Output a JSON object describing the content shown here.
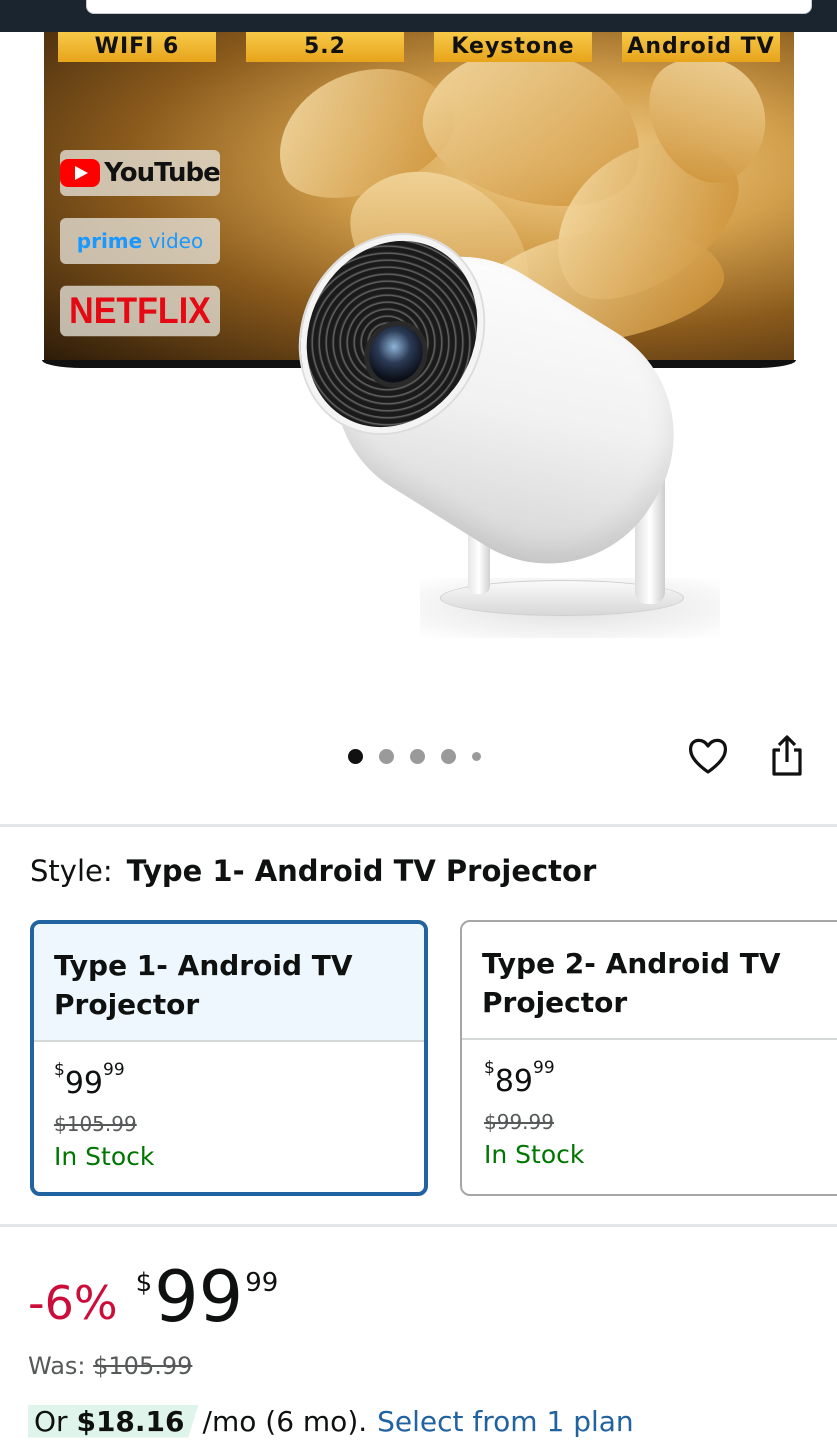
{
  "gallery": {
    "feature_tags": [
      "WIFI 6",
      "5.2",
      "Keystone",
      "Android TV"
    ],
    "app_badges": {
      "youtube": "YouTube",
      "prime_a": "prime",
      "prime_b": "video",
      "netflix": "NETFLIX"
    },
    "page_count": 5,
    "current_index": 0
  },
  "actions": {
    "wishlist_icon": "heart-outline-icon",
    "share_icon": "share-icon"
  },
  "style": {
    "label": "Style:",
    "value": "Type 1- Android TV Projector"
  },
  "options": [
    {
      "title_line1": "Type 1- Android TV",
      "title_line2": "Projector",
      "price_symbol": "$",
      "price_whole": "99",
      "price_fraction": "99",
      "was_price": "$105.99",
      "stock": "In Stock",
      "selected": true
    },
    {
      "title_line1": "Type 2- Android TV",
      "title_line2": "Projector",
      "price_symbol": "$",
      "price_whole": "89",
      "price_fraction": "99",
      "was_price": "$99.99",
      "stock": "In Stock",
      "selected": false
    }
  ],
  "pricing": {
    "discount": "-6%",
    "currency": "$",
    "whole": "99",
    "fraction": "99",
    "was_label": "Was:",
    "was_price": "$105.99",
    "installment_prefix": "Or",
    "installment_amount": "$18.16",
    "installment_term": "/mo (6 mo).",
    "installment_link": "Select from 1 plan"
  },
  "colors": {
    "accent_blue": "#2162a1",
    "deal_red": "#cc0c39",
    "stock_green": "#007600",
    "selected_bg": "#edf7fd"
  }
}
